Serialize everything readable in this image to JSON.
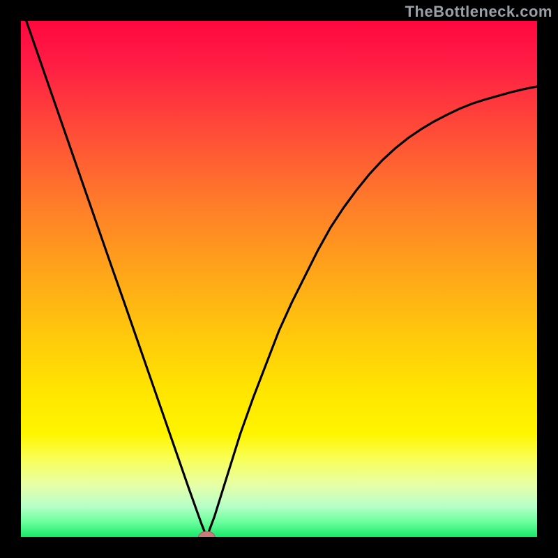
{
  "watermark": "TheBottleneck.com",
  "chart_data": {
    "type": "line",
    "title": "",
    "xlabel": "",
    "ylabel": "",
    "xlim": [
      0,
      1
    ],
    "ylim": [
      0,
      1
    ],
    "x": [
      0.0,
      0.025,
      0.05,
      0.075,
      0.1,
      0.125,
      0.15,
      0.175,
      0.2,
      0.225,
      0.25,
      0.275,
      0.3,
      0.325,
      0.35,
      0.36,
      0.375,
      0.4,
      0.425,
      0.45,
      0.475,
      0.5,
      0.525,
      0.55,
      0.575,
      0.6,
      0.625,
      0.65,
      0.675,
      0.7,
      0.725,
      0.75,
      0.775,
      0.8,
      0.825,
      0.85,
      0.875,
      0.9,
      0.925,
      0.95,
      0.975,
      1.0
    ],
    "y": [
      1.03,
      0.958,
      0.886,
      0.814,
      0.742,
      0.67,
      0.598,
      0.526,
      0.455,
      0.383,
      0.311,
      0.239,
      0.167,
      0.095,
      0.025,
      0.0,
      0.04,
      0.12,
      0.2,
      0.27,
      0.335,
      0.4,
      0.455,
      0.505,
      0.555,
      0.6,
      0.638,
      0.672,
      0.703,
      0.73,
      0.753,
      0.773,
      0.79,
      0.805,
      0.818,
      0.83,
      0.84,
      0.848,
      0.855,
      0.862,
      0.868,
      0.873
    ],
    "minimum_point": {
      "x": 0.36,
      "y": 0.0
    },
    "grid": false,
    "legend": false,
    "background": "gradient (red → orange → yellow → green, top to bottom)"
  },
  "visuals": {
    "curve_stroke": "#000000",
    "curve_stroke_width": 3.2,
    "gradient_stops": [
      {
        "offset": "0%",
        "color": "#ff0840"
      },
      {
        "offset": "8%",
        "color": "#ff1c44"
      },
      {
        "offset": "20%",
        "color": "#ff4739"
      },
      {
        "offset": "35%",
        "color": "#ff7b2a"
      },
      {
        "offset": "48%",
        "color": "#ffa31a"
      },
      {
        "offset": "60%",
        "color": "#ffc60d"
      },
      {
        "offset": "72%",
        "color": "#ffe600"
      },
      {
        "offset": "80%",
        "color": "#fff500"
      },
      {
        "offset": "85%",
        "color": "#f8ff5a"
      },
      {
        "offset": "90%",
        "color": "#e6ffa8"
      },
      {
        "offset": "94%",
        "color": "#b6ffc8"
      },
      {
        "offset": "97%",
        "color": "#6eff9e"
      },
      {
        "offset": "100%",
        "color": "#17e868"
      }
    ],
    "marker": {
      "cx": 0.36,
      "cy": 0.0,
      "rx": 0.016,
      "ry": 0.011,
      "fill": "#c97a7a",
      "stroke": "#a85a5a"
    }
  }
}
